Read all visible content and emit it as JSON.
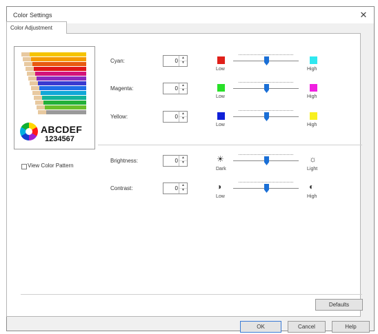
{
  "window": {
    "title": "Color Settings",
    "close_glyph": "✕"
  },
  "tabs": [
    {
      "label": "Color Adjustment"
    }
  ],
  "preview": {
    "line1": "ABCDEF",
    "line2": "1234567",
    "pencil_colors": [
      "#f5c400",
      "#f59a00",
      "#e85a10",
      "#e01818",
      "#d4147a",
      "#8a2bbf",
      "#3a3ad0",
      "#1f6ee8",
      "#10a7d8",
      "#12b39a",
      "#24b03a",
      "#6bbf2a",
      "#9a9a9a"
    ]
  },
  "view_color_pattern": {
    "label": "View Color Pattern",
    "checked": false
  },
  "adjustments": [
    {
      "label": "Cyan:",
      "value": "0",
      "low_label": "Low",
      "high_label": "High",
      "low_color": "#e0201a",
      "high_color": "#30e8f0",
      "level": 0.5
    },
    {
      "label": "Magenta:",
      "value": "0",
      "low_label": "Low",
      "high_label": "High",
      "low_color": "#28e028",
      "high_color": "#f020e0",
      "level": 0.5
    },
    {
      "label": "Yellow:",
      "value": "0",
      "low_label": "Low",
      "high_label": "High",
      "low_color": "#1020d8",
      "high_color": "#f8f020",
      "level": 0.5
    },
    {
      "label": "Brightness:",
      "value": "0",
      "low_label": "Dark",
      "high_label": "Light",
      "low_icon": "sun-dim-icon",
      "high_icon": "sun-bright-icon",
      "low_glyph": "☀",
      "high_glyph": "☼",
      "level": 0.5
    },
    {
      "label": "Contrast:",
      "value": "0",
      "low_label": "Low",
      "high_label": "High",
      "low_icon": "contrast-low-icon",
      "high_icon": "contrast-high-icon",
      "low_glyph": "◑",
      "high_glyph": "◐",
      "level": 0.5
    }
  ],
  "buttons": {
    "defaults": "Defaults",
    "ok": "OK",
    "cancel": "Cancel",
    "help": "Help"
  }
}
